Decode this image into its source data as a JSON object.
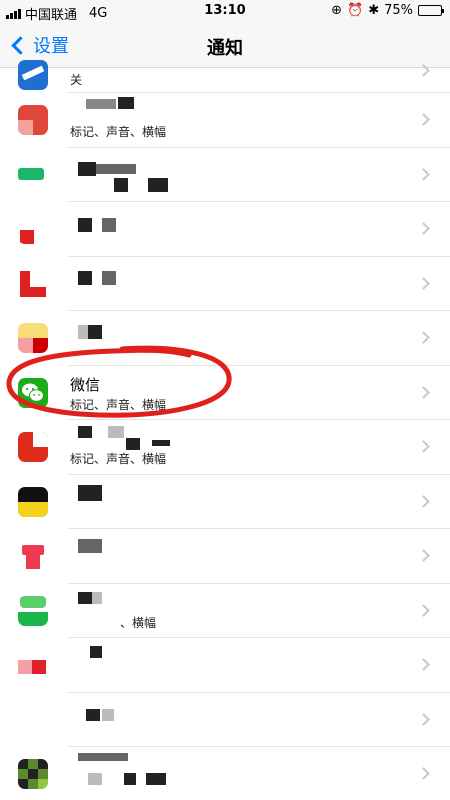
{
  "status_bar": {
    "carrier": "中国联通",
    "network": "4G",
    "time": "13:10",
    "battery": "75%",
    "battery_level": 0.75
  },
  "nav": {
    "back_label": "设置",
    "title": "通知"
  },
  "rows": [
    {
      "sub": "关"
    },
    {
      "name": "",
      "sub": "标记、声音、横幅"
    },
    {
      "name": "",
      "sub": ""
    },
    {
      "name": "",
      "sub": ""
    },
    {
      "name": "",
      "sub": ""
    },
    {
      "name": "",
      "sub": ""
    },
    {
      "name": "微信",
      "sub": "标记、声音、横幅"
    },
    {
      "name": "",
      "sub": "标记、声音、横幅"
    },
    {
      "name": "",
      "sub": ""
    },
    {
      "name": "",
      "sub": ""
    },
    {
      "name": "",
      "sub": "、横幅"
    },
    {
      "name": "",
      "sub": ""
    },
    {
      "name": "",
      "sub": ""
    },
    {
      "name": "",
      "sub": ""
    }
  ],
  "colors": {
    "accent": "#007aff",
    "wechat": "#1aad19",
    "annotation": "#e0201b"
  }
}
